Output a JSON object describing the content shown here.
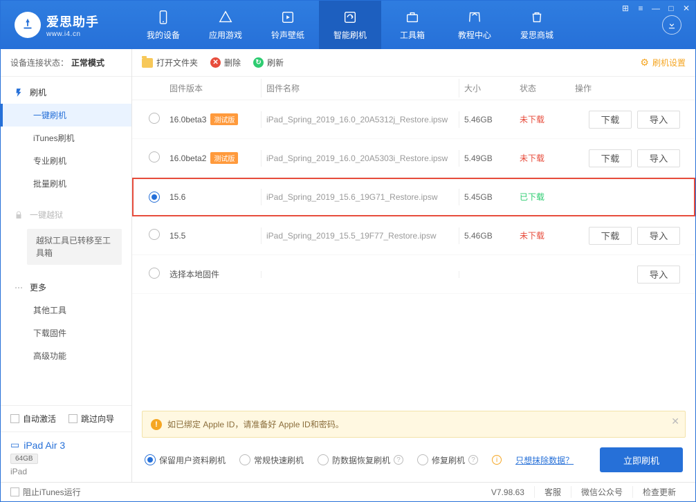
{
  "app": {
    "name": "爱思助手",
    "url": "www.i4.cn"
  },
  "window_controls": [
    "⊞",
    "≡",
    "—",
    "□",
    "✕"
  ],
  "nav": [
    {
      "label": "我的设备"
    },
    {
      "label": "应用游戏"
    },
    {
      "label": "铃声壁纸"
    },
    {
      "label": "智能刷机"
    },
    {
      "label": "工具箱"
    },
    {
      "label": "教程中心"
    },
    {
      "label": "爱思商城"
    }
  ],
  "sidebar": {
    "status_label": "设备连接状态：",
    "status_value": "正常模式",
    "sections": {
      "flash": {
        "title": "刷机",
        "items": [
          "一键刷机",
          "iTunes刷机",
          "专业刷机",
          "批量刷机"
        ]
      },
      "jailbreak": {
        "title": "一键越狱",
        "note": "越狱工具已转移至工具箱"
      },
      "more": {
        "title": "更多",
        "items": [
          "其他工具",
          "下载固件",
          "高级功能"
        ]
      }
    },
    "auto_activate": "自动激活",
    "skip_guide": "跳过向导",
    "device": {
      "name": "iPad Air 3",
      "capacity": "64GB",
      "type": "iPad"
    }
  },
  "toolbar": {
    "open": "打开文件夹",
    "delete": "删除",
    "refresh": "刷新",
    "settings": "刷机设置"
  },
  "columns": {
    "version": "固件版本",
    "name": "固件名称",
    "size": "大小",
    "status": "状态",
    "ops": "操作"
  },
  "rows": [
    {
      "version": "16.0beta3",
      "badge": "测试版",
      "name": "iPad_Spring_2019_16.0_20A5312j_Restore.ipsw",
      "size": "5.46GB",
      "status": "未下载",
      "status_cls": "status-not",
      "selected": false,
      "show_ops": true
    },
    {
      "version": "16.0beta2",
      "badge": "测试版",
      "name": "iPad_Spring_2019_16.0_20A5303i_Restore.ipsw",
      "size": "5.49GB",
      "status": "未下载",
      "status_cls": "status-not",
      "selected": false,
      "show_ops": true
    },
    {
      "version": "15.6",
      "badge": "",
      "name": "iPad_Spring_2019_15.6_19G71_Restore.ipsw",
      "size": "5.45GB",
      "status": "已下载",
      "status_cls": "status-done",
      "selected": true,
      "show_ops": false,
      "highlight": true
    },
    {
      "version": "15.5",
      "badge": "",
      "name": "iPad_Spring_2019_15.5_19F77_Restore.ipsw",
      "size": "5.46GB",
      "status": "未下载",
      "status_cls": "status-not",
      "selected": false,
      "show_ops": true
    },
    {
      "version": "选择本地固件",
      "badge": "",
      "name": "",
      "size": "",
      "status": "",
      "status_cls": "",
      "selected": false,
      "show_ops": false,
      "local": true
    }
  ],
  "ops": {
    "download": "下载",
    "import": "导入"
  },
  "notice": "如已绑定 Apple ID，请准备好 Apple ID和密码。",
  "flash_options": [
    "保留用户资料刷机",
    "常规快速刷机",
    "防数据恢复刷机",
    "修复刷机"
  ],
  "erase_link": "只想抹除数据？",
  "flash_button": "立即刷机",
  "footer": {
    "block_itunes": "阻止iTunes运行",
    "version": "V7.98.63",
    "service": "客服",
    "wechat": "微信公众号",
    "update": "检查更新"
  }
}
